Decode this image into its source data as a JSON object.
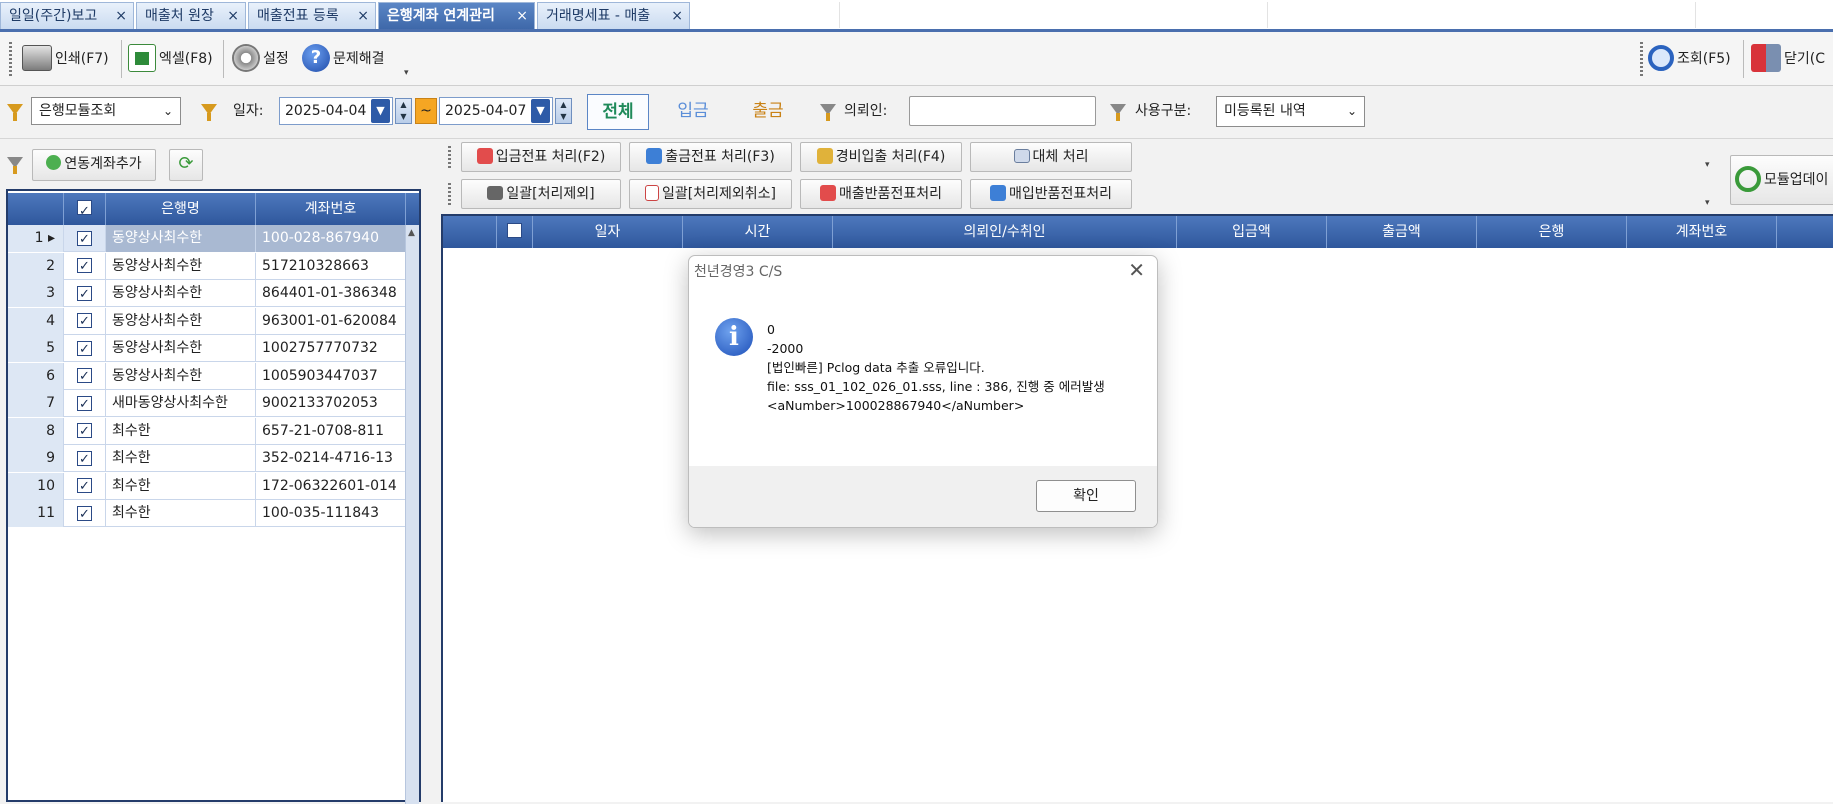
{
  "tabs": [
    {
      "label": "일일(주간)보고",
      "active": false
    },
    {
      "label": "매출처 원장",
      "active": false
    },
    {
      "label": "매출전표 등록",
      "active": false
    },
    {
      "label": "은행계좌 연계관리",
      "active": true
    },
    {
      "label": "거래명세표 - 매출",
      "active": false
    }
  ],
  "tab_close": "×",
  "toolbar": {
    "print": "인쇄(F7)",
    "excel": "엑셀(F8)",
    "settings": "설정",
    "help": "문제해결",
    "search": "조회(F5)",
    "close": "닫기(C"
  },
  "filter": {
    "mode": "은행모듈조회",
    "date_label": "일자:",
    "date_from": "2025-04-04",
    "date_to": "2025-04-07",
    "tilde": "~",
    "all": "전체",
    "deposit": "입금",
    "withdraw": "출금",
    "client_label": "의뢰인:",
    "client_value": "",
    "usage_label": "사용구분:",
    "usage_value": "미등록된 내역"
  },
  "left_toolbar": {
    "add_account": "연동계좌추가"
  },
  "actions": {
    "row1": [
      "입금전표 처리(F2)",
      "출금전표 처리(F3)",
      "경비입출 처리(F4)",
      "대체 처리"
    ],
    "row2": [
      "일괄[처리제외]",
      "일괄[처리제외취소]",
      "매출반품전표처리",
      "매입반품전표처리"
    ],
    "module_update": "모듈업데이"
  },
  "account_grid": {
    "headers": {
      "bank": "은행명",
      "account": "계좌번호"
    },
    "rows": [
      {
        "no": "1",
        "checked": true,
        "bank": "동양상사최수한",
        "account": "100-028-867940",
        "selected": true
      },
      {
        "no": "2",
        "checked": true,
        "bank": "동양상사최수한",
        "account": "517210328663"
      },
      {
        "no": "3",
        "checked": true,
        "bank": "동양상사최수한",
        "account": "864401-01-386348"
      },
      {
        "no": "4",
        "checked": true,
        "bank": "동양상사최수한",
        "account": "963001-01-620084"
      },
      {
        "no": "5",
        "checked": true,
        "bank": "동양상사최수한",
        "account": "1002757770732"
      },
      {
        "no": "6",
        "checked": true,
        "bank": "동양상사최수한",
        "account": "1005903447037"
      },
      {
        "no": "7",
        "checked": true,
        "bank": "새마동양상사최수한",
        "account": "9002133702053"
      },
      {
        "no": "8",
        "checked": true,
        "bank": "최수한",
        "account": "657-21-0708-811"
      },
      {
        "no": "9",
        "checked": true,
        "bank": "최수한",
        "account": "352-0214-4716-13"
      },
      {
        "no": "10",
        "checked": true,
        "bank": "최수한",
        "account": "172-06322601-014"
      },
      {
        "no": "11",
        "checked": true,
        "bank": "최수한",
        "account": "100-035-111843"
      }
    ]
  },
  "tx_grid": {
    "headers": [
      "일자",
      "시간",
      "의뢰인/수취인",
      "입금액",
      "출금액",
      "은행",
      "계좌번호"
    ]
  },
  "dialog": {
    "title": "천년경영3 C/S",
    "close": "✕",
    "lines": [
      "0",
      "-2000",
      "[법인빠른] Pclog data 추출 오류입니다.",
      "file: sss_01_102_026_01.sss, line : 386, 진행 중 에러발생",
      "<aNumber>100028867940</aNumber>"
    ],
    "ok": "확인"
  },
  "colors": {
    "tab_active": "#3d67a8",
    "header_blue": "#2f579c",
    "deposit": "#5b8ed8",
    "withdraw": "#c98216",
    "all": "#1f8a5a"
  }
}
